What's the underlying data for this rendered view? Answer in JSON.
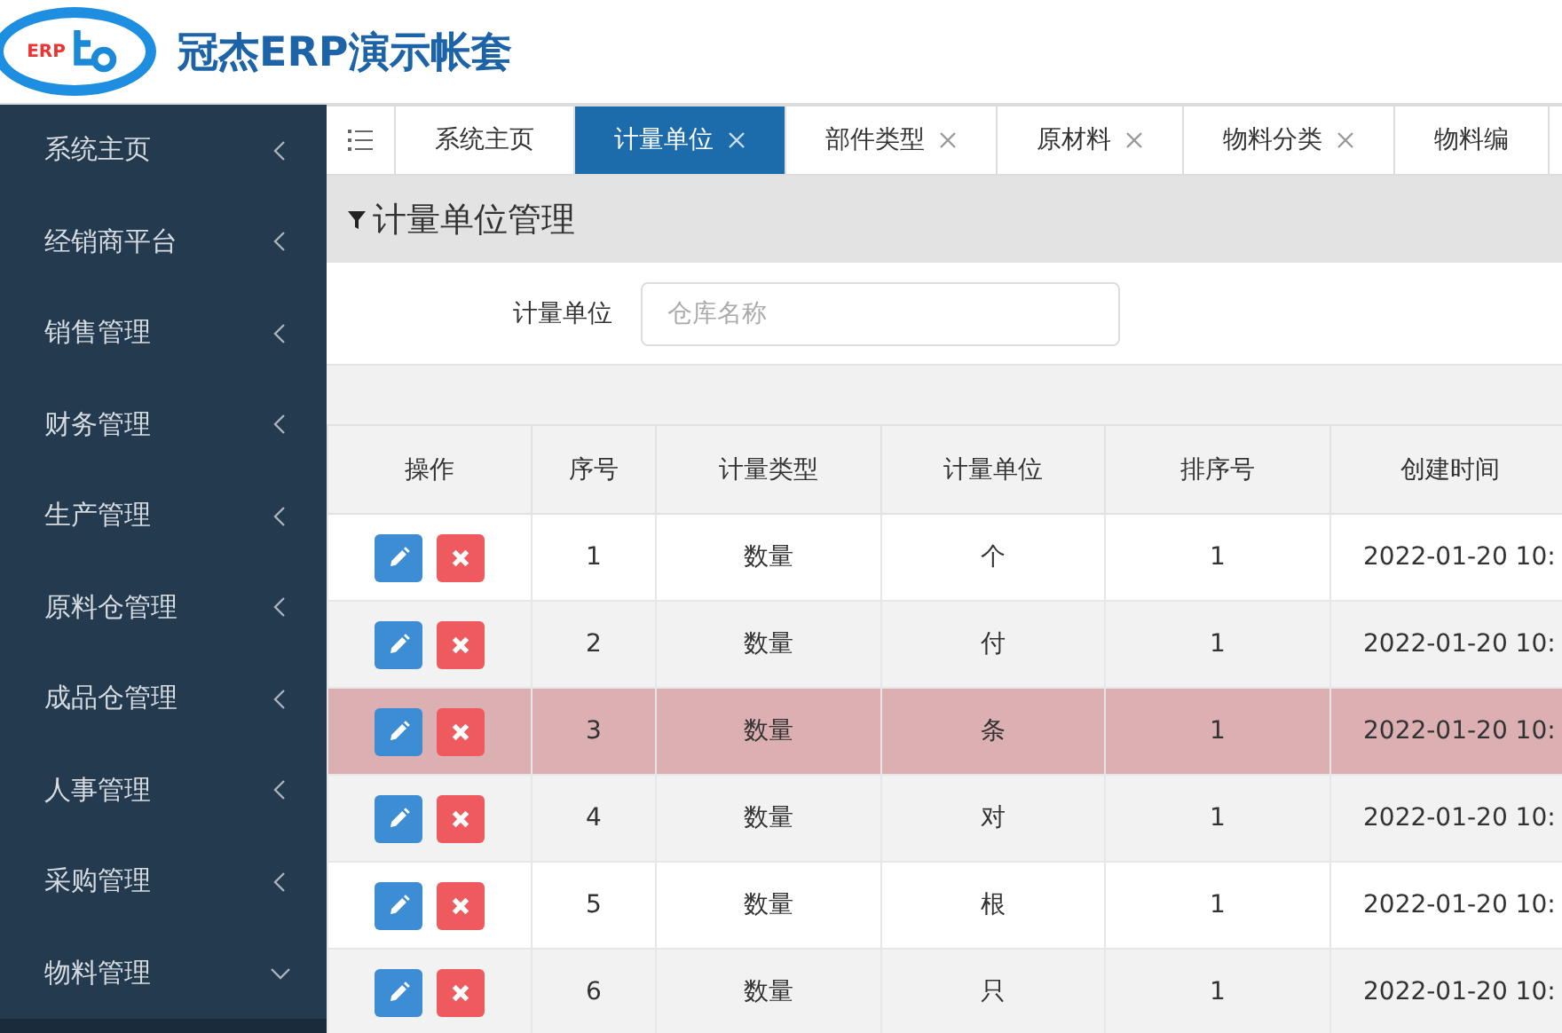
{
  "header": {
    "logo_text": "ERP",
    "title": "冠杰ERP演示帐套"
  },
  "sidebar": {
    "items": [
      {
        "label": "系统主页",
        "expanded": false
      },
      {
        "label": "经销商平台",
        "expanded": false
      },
      {
        "label": "销售管理",
        "expanded": false
      },
      {
        "label": "财务管理",
        "expanded": false
      },
      {
        "label": "生产管理",
        "expanded": false
      },
      {
        "label": "原料仓管理",
        "expanded": false
      },
      {
        "label": "成品仓管理",
        "expanded": false
      },
      {
        "label": "人事管理",
        "expanded": false
      },
      {
        "label": "采购管理",
        "expanded": false
      },
      {
        "label": "物料管理",
        "expanded": true
      }
    ]
  },
  "tabs": [
    {
      "label": "系统主页",
      "selected": false,
      "closable": false
    },
    {
      "label": "计量单位",
      "selected": true,
      "closable": true
    },
    {
      "label": "部件类型",
      "selected": false,
      "closable": true
    },
    {
      "label": "原材料",
      "selected": false,
      "closable": true
    },
    {
      "label": "物料分类",
      "selected": false,
      "closable": true
    },
    {
      "label": "物料编",
      "selected": false,
      "closable": false
    }
  ],
  "panel": {
    "title": "计量单位管理"
  },
  "filter": {
    "label": "计量单位",
    "placeholder": "仓库名称"
  },
  "table": {
    "columns": [
      "操作",
      "序号",
      "计量类型",
      "计量单位",
      "排序号",
      "创建时间"
    ],
    "rows": [
      {
        "cells": [
          "",
          "1",
          "数量",
          "个",
          "1",
          "2022-01-20 10:"
        ],
        "selected": false
      },
      {
        "cells": [
          "",
          "2",
          "数量",
          "付",
          "1",
          "2022-01-20 10:"
        ],
        "selected": false
      },
      {
        "cells": [
          "",
          "3",
          "数量",
          "条",
          "1",
          "2022-01-20 10:"
        ],
        "selected": true
      },
      {
        "cells": [
          "",
          "4",
          "数量",
          "对",
          "1",
          "2022-01-20 10:"
        ],
        "selected": false
      },
      {
        "cells": [
          "",
          "5",
          "数量",
          "根",
          "1",
          "2022-01-20 10:"
        ],
        "selected": false
      },
      {
        "cells": [
          "",
          "6",
          "数量",
          "只",
          "1",
          "2022-01-20 10:"
        ],
        "selected": false
      }
    ]
  }
}
